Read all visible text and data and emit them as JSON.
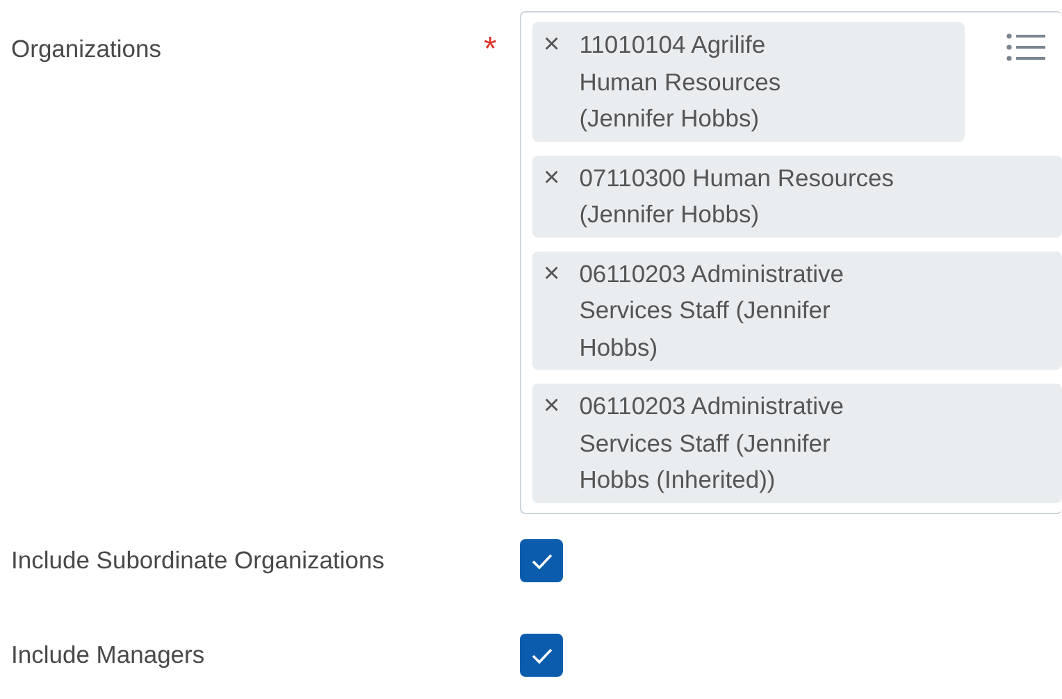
{
  "organizations": {
    "label": "Organizations",
    "required_mark": "*",
    "chips": [
      {
        "remove": "×",
        "text": "11010104 Agrilife\nHuman Resources\n(Jennifer Hobbs)"
      },
      {
        "remove": "×",
        "text": "07110300 Human Resources\n(Jennifer Hobbs)"
      },
      {
        "remove": "×",
        "text": "06110203 Administrative\nServices Staff (Jennifer\nHobbs)"
      },
      {
        "remove": "×",
        "text": "06110203 Administrative\nServices Staff (Jennifer\nHobbs (Inherited))"
      }
    ]
  },
  "options": [
    {
      "label": "Include Subordinate Organizations",
      "checked": true
    },
    {
      "label": "Include Managers",
      "checked": true
    }
  ]
}
